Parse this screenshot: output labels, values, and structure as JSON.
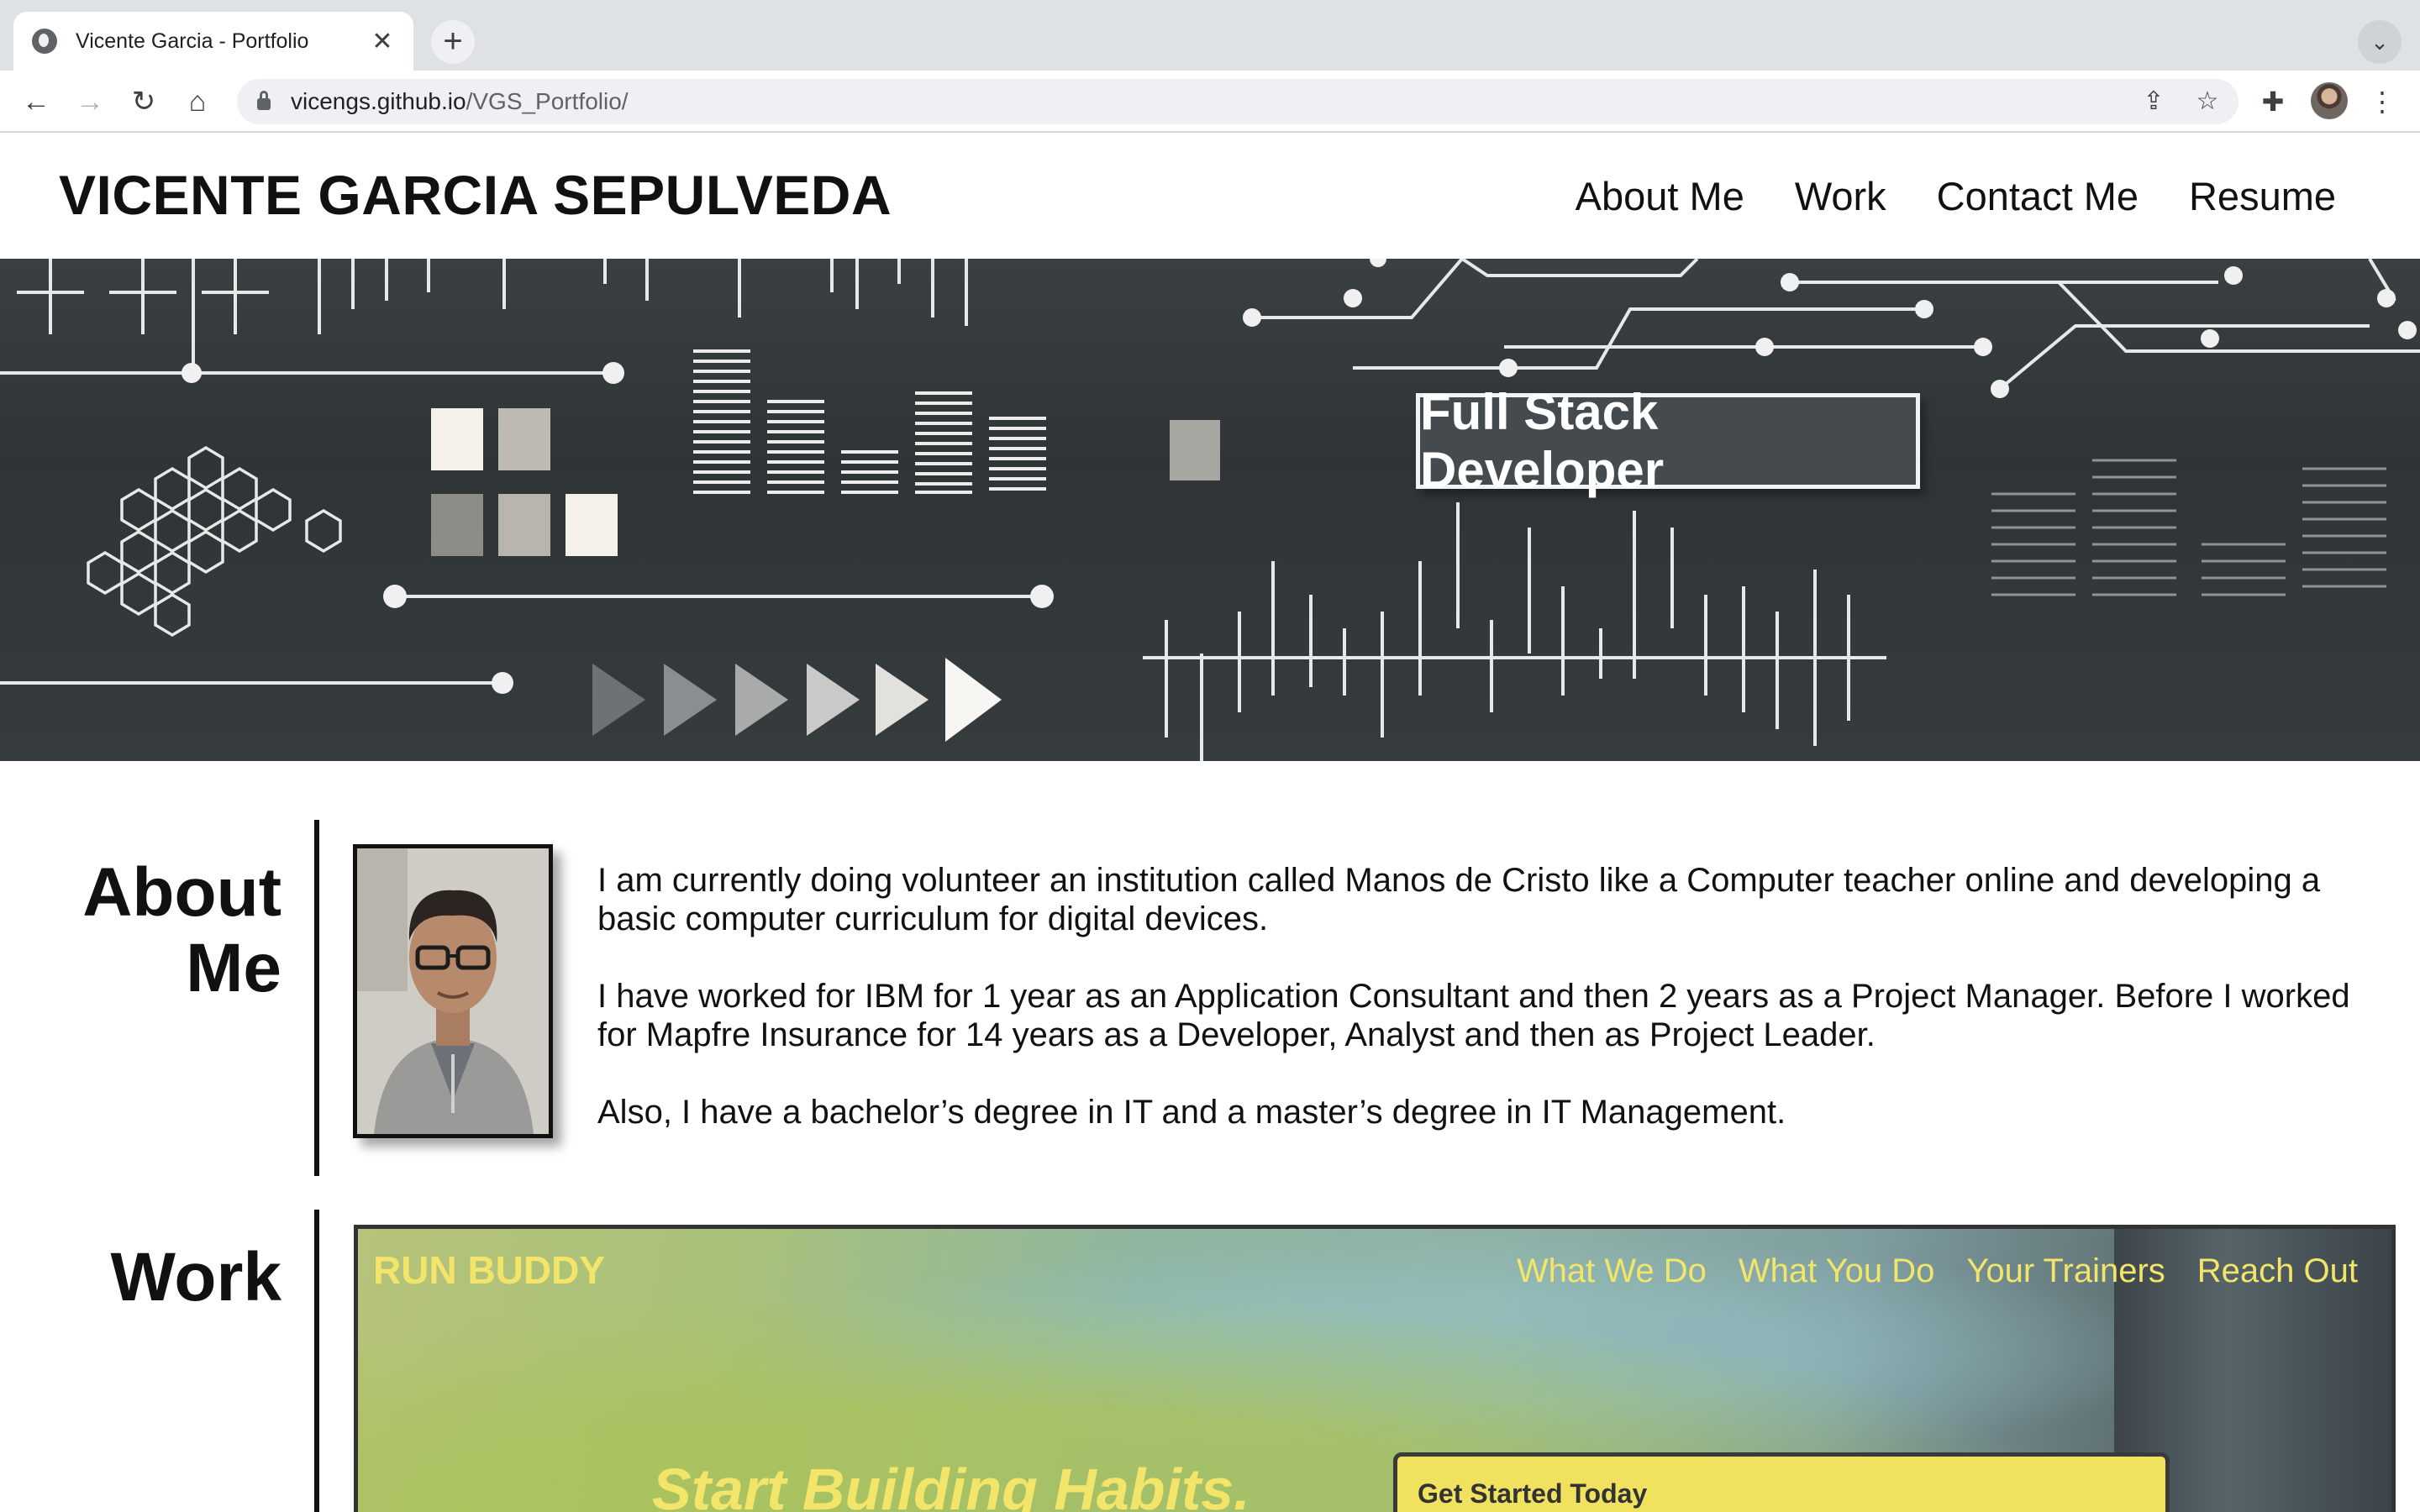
{
  "browser": {
    "tab_title": "Vicente Garcia - Portfolio",
    "url_host": "vicengs.github.io",
    "url_path": "/VGS_Portfolio/"
  },
  "site": {
    "name": "VICENTE GARCIA SEPULVEDA",
    "nav": [
      "About Me",
      "Work",
      "Contact Me",
      "Resume"
    ]
  },
  "hero": {
    "badge": "Full Stack Developer"
  },
  "about": {
    "heading_line1": "About",
    "heading_line2": "Me",
    "paragraphs": [
      "I am currently doing volunteer an institution called Manos de Cristo like a Computer teacher online and developing a basic computer curriculum for digital devices.",
      "I have worked for IBM for 1 year as an Application Consultant and then 2 years as a Project Manager. Before I worked for Mapfre Insurance for 14 years as a Developer, Analyst and then as Project Leader.",
      "Also, I have a bachelor’s degree in IT and a master’s degree in IT Management."
    ]
  },
  "work": {
    "heading": "Work",
    "project": {
      "logo": "RUN BUDDY",
      "nav": [
        "What We Do",
        "What You Do",
        "Your Trainers",
        "Reach Out"
      ],
      "tagline": "Start Building Habits.",
      "form_title": "Get Started Today"
    }
  }
}
